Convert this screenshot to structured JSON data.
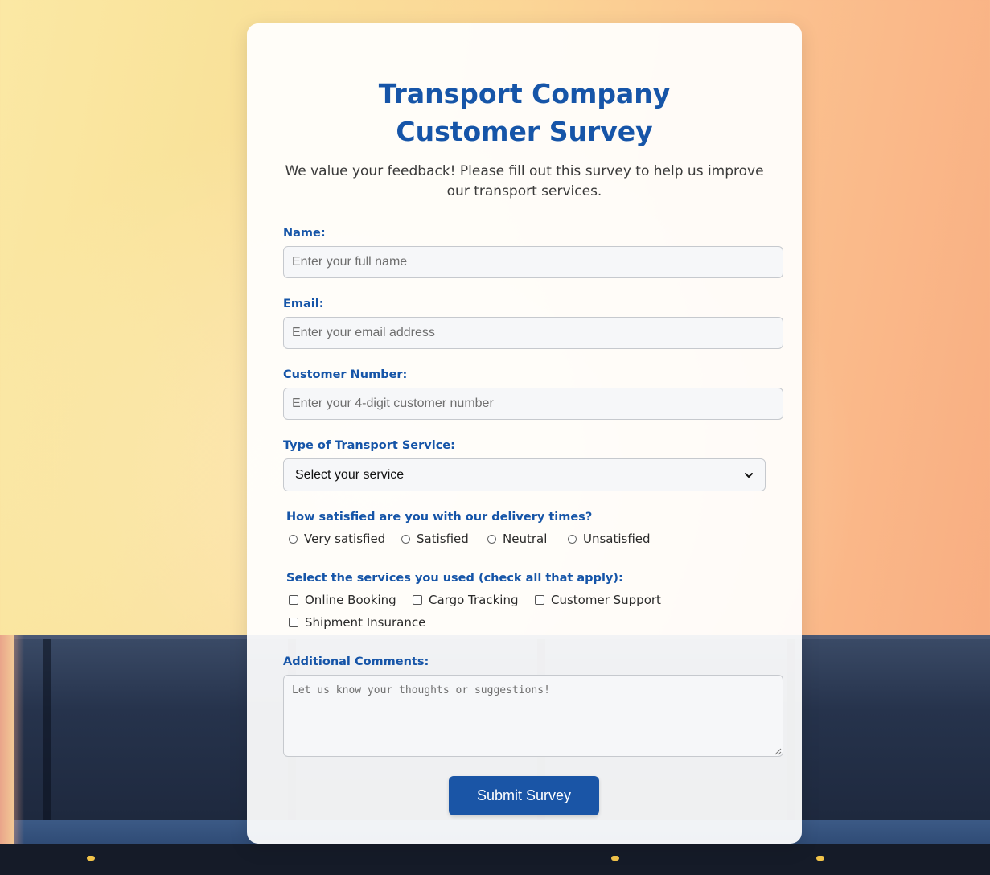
{
  "form": {
    "title": "Transport Company Customer Survey",
    "intro": "We value your feedback! Please fill out this survey to help us improve our transport services.",
    "name": {
      "label": "Name:",
      "placeholder": "Enter your full name"
    },
    "email": {
      "label": "Email:",
      "placeholder": "Enter your email address"
    },
    "customer_number": {
      "label": "Customer Number:",
      "placeholder": "Enter your 4-digit customer number"
    },
    "service_type": {
      "label": "Type of Transport Service:",
      "selected": "Select your service"
    },
    "satisfaction": {
      "question": "How satisfied are you with our delivery times?",
      "options": [
        "Very satisfied",
        "Satisfied",
        "Neutral",
        "Unsatisfied"
      ]
    },
    "services_used": {
      "question": "Select the services you used (check all that apply):",
      "options": [
        "Online Booking",
        "Cargo Tracking",
        "Customer Support",
        "Shipment Insurance"
      ]
    },
    "comments": {
      "label": "Additional Comments:",
      "placeholder": "Let us know your thoughts or suggestions!"
    },
    "submit_label": "Submit Survey"
  },
  "colors": {
    "accent": "#1655a8",
    "button": "#1a55a6"
  }
}
